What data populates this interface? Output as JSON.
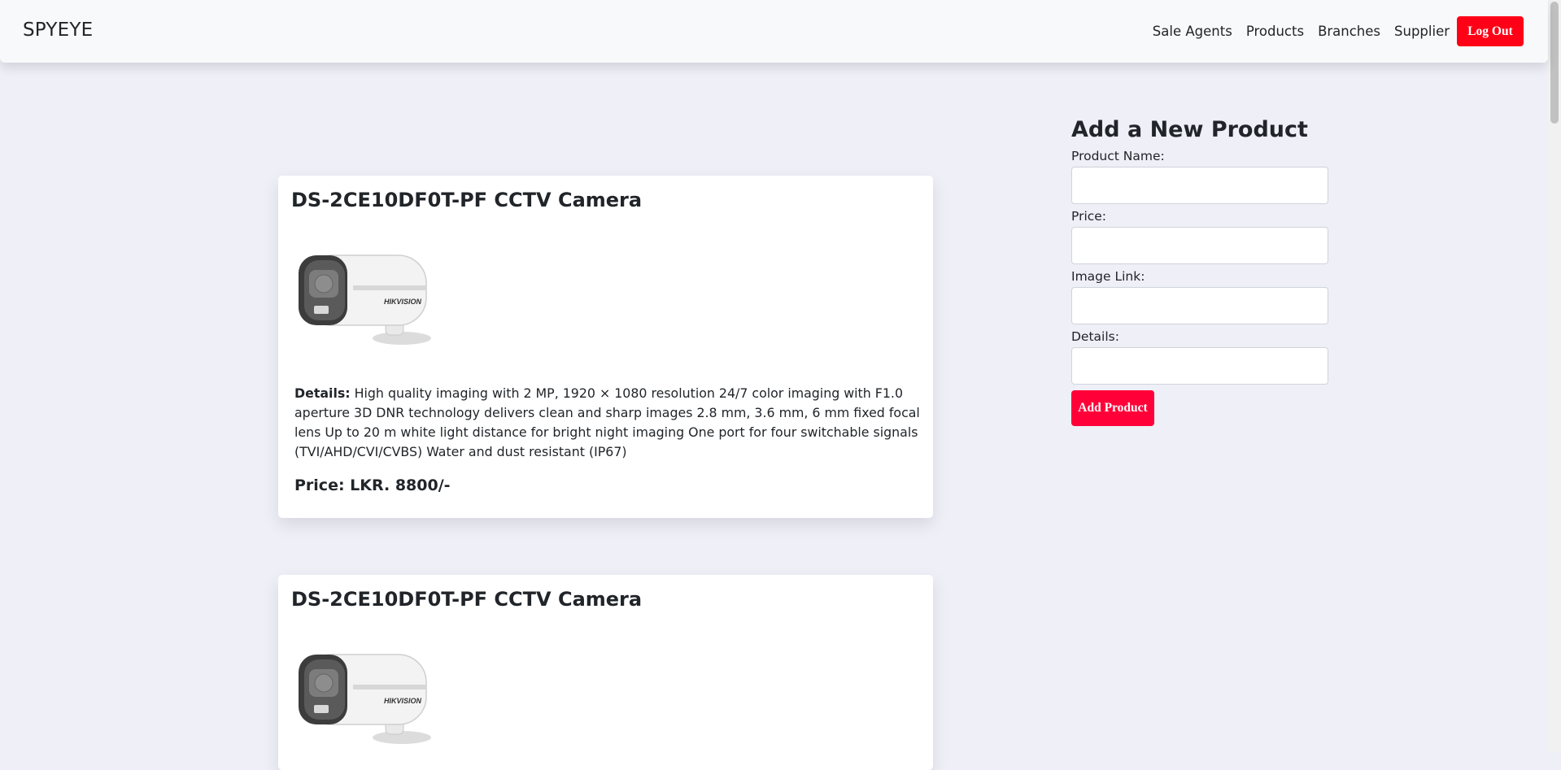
{
  "navbar": {
    "brand": "SPYEYE",
    "links": [
      "Sale Agents",
      "Products",
      "Branches",
      "Supplier"
    ],
    "logout_label": "Log Out"
  },
  "products": [
    {
      "title": "DS-2CE10DF0T-PF CCTV Camera",
      "image": "cctv-camera-image",
      "details_label": "Details:",
      "details": "High quality imaging with 2 MP, 1920 × 1080 resolution 24/7 color imaging with F1.0 aperture 3D DNR technology delivers clean and sharp images 2.8 mm, 3.6 mm, 6 mm fixed focal lens Up to 20 m white light distance for bright night imaging One port for four switchable signals (TVI/AHD/CVI/CVBS) Water and dust resistant (IP67)",
      "price": "Price: LKR. 8800/-"
    },
    {
      "title": "DS-2CE10DF0T-PF CCTV Camera",
      "image": "cctv-camera-image"
    }
  ],
  "form": {
    "title": "Add a New Product",
    "fields": [
      {
        "label": "Product Name:",
        "value": ""
      },
      {
        "label": "Price:",
        "value": ""
      },
      {
        "label": "Image Link:",
        "value": ""
      },
      {
        "label": "Details:",
        "value": ""
      }
    ],
    "submit_label": "Add Product"
  },
  "colors": {
    "accent_red": "#ff0016",
    "add_button": "#ff0038",
    "background": "#eeeff7"
  }
}
